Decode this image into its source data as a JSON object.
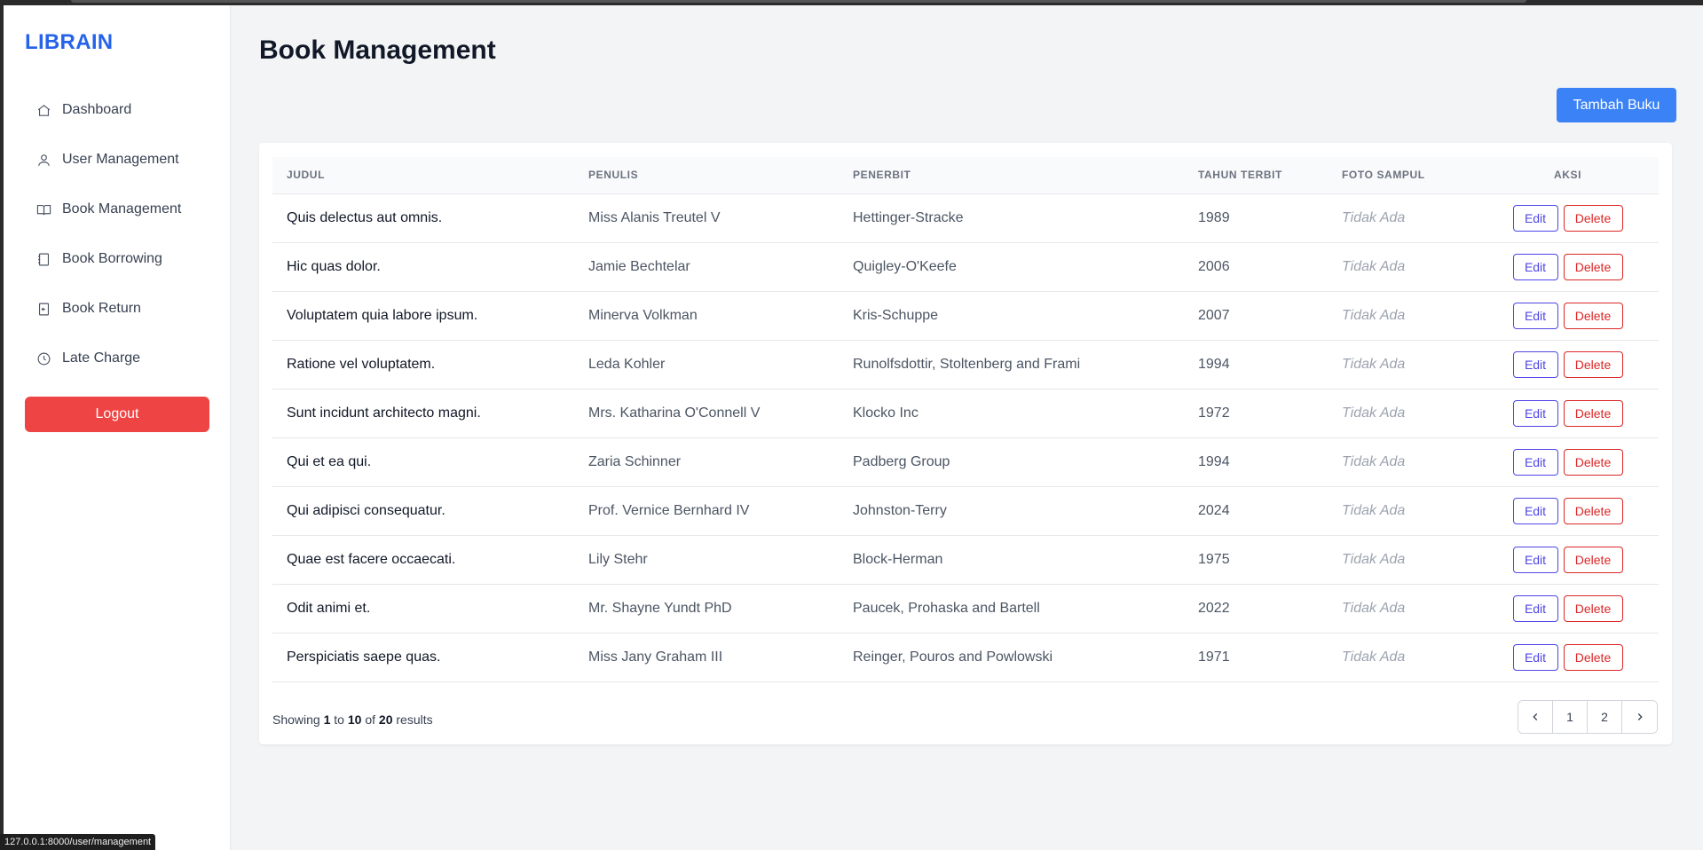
{
  "brand": "LIBRAIN",
  "sidebar": {
    "items": [
      {
        "label": "Dashboard",
        "icon": "home-icon"
      },
      {
        "label": "User Management",
        "icon": "user-icon"
      },
      {
        "label": "Book Management",
        "icon": "book-open-icon"
      },
      {
        "label": "Book Borrowing",
        "icon": "notebook-icon"
      },
      {
        "label": "Book Return",
        "icon": "return-icon"
      },
      {
        "label": "Late Charge",
        "icon": "clock-icon"
      }
    ],
    "logout_label": "Logout"
  },
  "page": {
    "title": "Book Management",
    "add_button_label": "Tambah Buku"
  },
  "table": {
    "headers": {
      "judul": "JUDUL",
      "penulis": "PENULIS",
      "penerbit": "PENERBIT",
      "tahun": "TAHUN TERBIT",
      "foto": "FOTO SAMPUL",
      "aksi": "AKSI"
    },
    "edit_label": "Edit",
    "delete_label": "Delete",
    "rows": [
      {
        "judul": "Quis delectus aut omnis.",
        "penulis": "Miss Alanis Treutel V",
        "penerbit": "Hettinger-Stracke",
        "tahun": "1989",
        "foto": "Tidak Ada"
      },
      {
        "judul": "Hic quas dolor.",
        "penulis": "Jamie Bechtelar",
        "penerbit": "Quigley-O'Keefe",
        "tahun": "2006",
        "foto": "Tidak Ada"
      },
      {
        "judul": "Voluptatem quia labore ipsum.",
        "penulis": "Minerva Volkman",
        "penerbit": "Kris-Schuppe",
        "tahun": "2007",
        "foto": "Tidak Ada"
      },
      {
        "judul": "Ratione vel voluptatem.",
        "penulis": "Leda Kohler",
        "penerbit": "Runolfsdottir, Stoltenberg and Frami",
        "tahun": "1994",
        "foto": "Tidak Ada"
      },
      {
        "judul": "Sunt incidunt architecto magni.",
        "penulis": "Mrs. Katharina O'Connell V",
        "penerbit": "Klocko Inc",
        "tahun": "1972",
        "foto": "Tidak Ada"
      },
      {
        "judul": "Qui et ea qui.",
        "penulis": "Zaria Schinner",
        "penerbit": "Padberg Group",
        "tahun": "1994",
        "foto": "Tidak Ada"
      },
      {
        "judul": "Qui adipisci consequatur.",
        "penulis": "Prof. Vernice Bernhard IV",
        "penerbit": "Johnston-Terry",
        "tahun": "2024",
        "foto": "Tidak Ada"
      },
      {
        "judul": "Quae est facere occaecati.",
        "penulis": "Lily Stehr",
        "penerbit": "Block-Herman",
        "tahun": "1975",
        "foto": "Tidak Ada"
      },
      {
        "judul": "Odit animi et.",
        "penulis": "Mr. Shayne Yundt PhD",
        "penerbit": "Paucek, Prohaska and Bartell",
        "tahun": "2022",
        "foto": "Tidak Ada"
      },
      {
        "judul": "Perspiciatis saepe quas.",
        "penulis": "Miss Jany Graham III",
        "penerbit": "Reinger, Pouros and Powlowski",
        "tahun": "1971",
        "foto": "Tidak Ada"
      }
    ]
  },
  "pagination": {
    "showing_prefix": "Showing",
    "from": "1",
    "to_word": "to",
    "to": "10",
    "of_word": "of",
    "total": "20",
    "results_word": "results",
    "pages": [
      "1",
      "2"
    ]
  },
  "statusbar": {
    "url": "127.0.0.1:8000/user/management"
  },
  "colors": {
    "brand": "#2563eb",
    "primary_button": "#3b82f6",
    "logout": "#ef4444",
    "edit": "#4f46e5",
    "delete": "#dc2626"
  }
}
